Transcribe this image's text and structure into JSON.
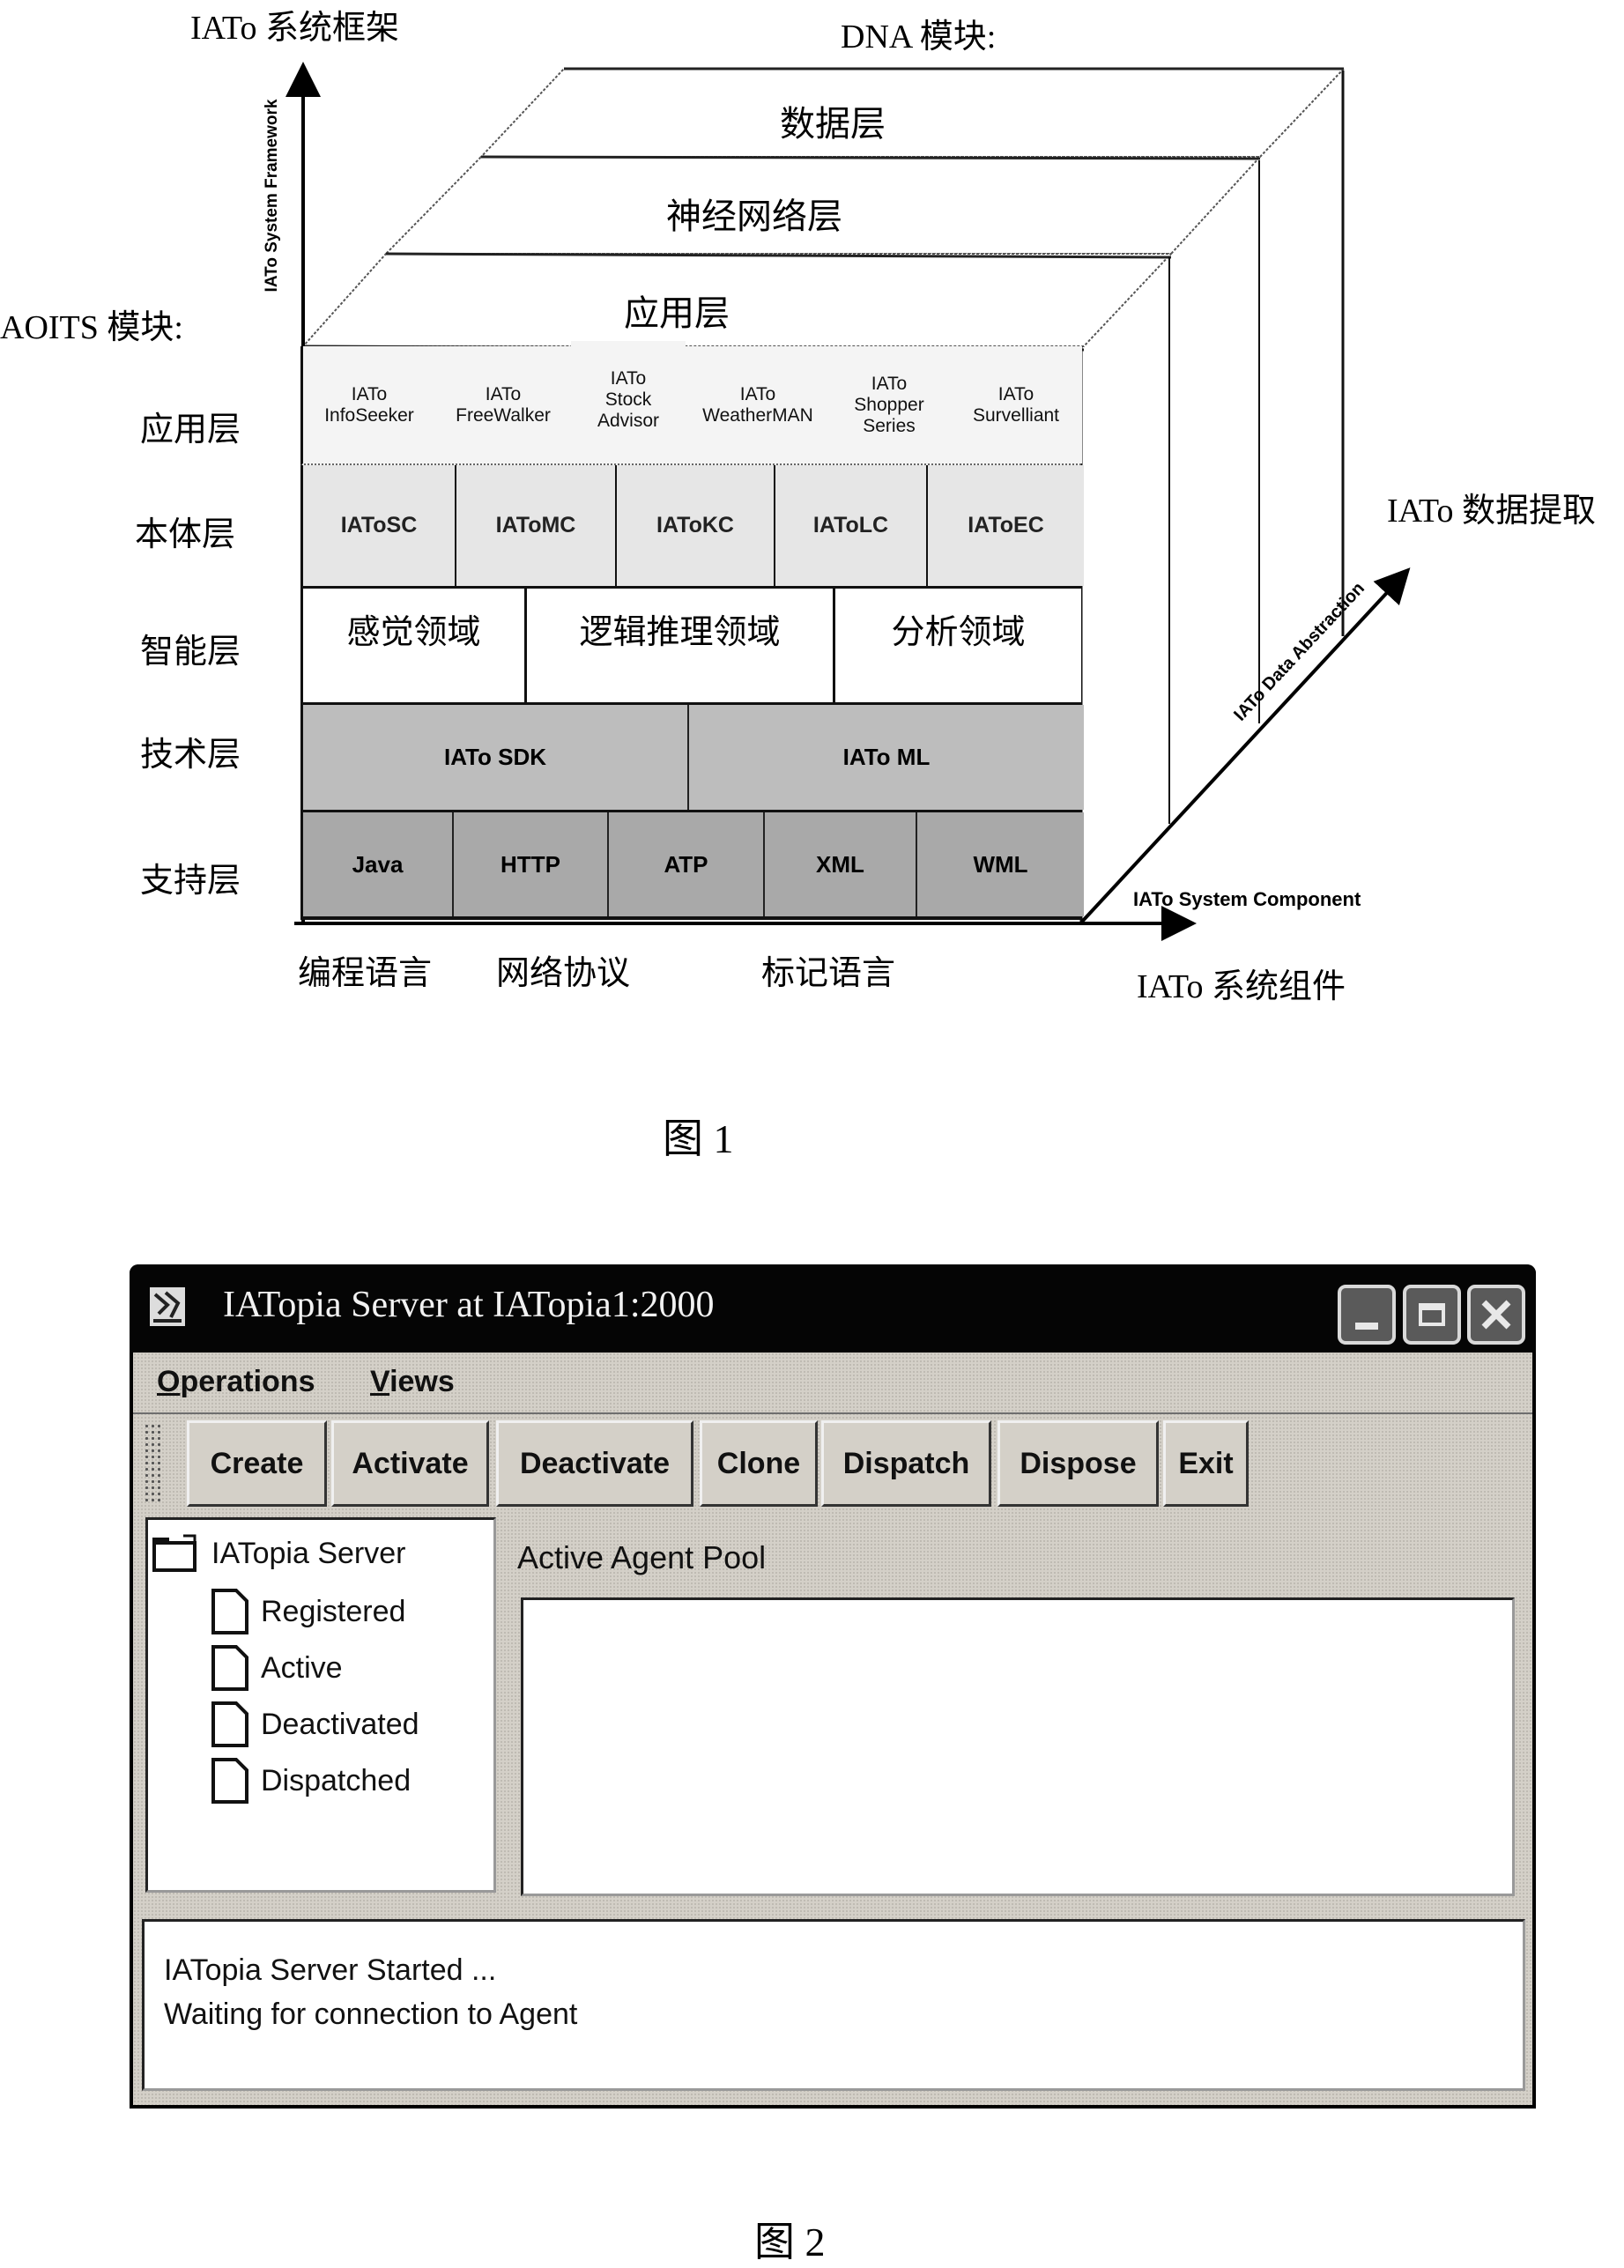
{
  "figure1": {
    "caption": "图 1",
    "y_axis_title": "IATo 系统框架",
    "y_axis_label": "IATo System Framework",
    "x_axis_title": "IATo 系统组件",
    "x_axis_label": "IATo System Component",
    "z_axis_title": "IATo 数据提取",
    "z_axis_label": "IATo Data Abstraction",
    "aoits_title": "AOITS 模块:",
    "dna_title": "DNA 模块:",
    "dna_layers": [
      "数据层",
      "神经网络层",
      "应用层"
    ],
    "aoits_layers": [
      {
        "label": "应用层",
        "cells": [
          "IATo\nInfoSeeker",
          "IATo\nFreeWalker",
          "IATo\nStock\nAdvisor",
          "IATo\nWeatherMAN",
          "IATo\nShopper\nSeries",
          "IATo\nSurvelliant"
        ]
      },
      {
        "label": "本体层",
        "cells": [
          "IAToSC",
          "IAToMC",
          "IAToKC",
          "IAToLC",
          "IAToEC"
        ]
      },
      {
        "label": "智能层",
        "cells": [
          "感觉领域",
          "逻辑推理领域",
          "分析领域"
        ]
      },
      {
        "label": "技术层",
        "cells": [
          "IATo SDK",
          "IATo ML"
        ]
      },
      {
        "label": "支持层",
        "cells": [
          "Java",
          "HTTP",
          "ATP",
          "XML",
          "WML"
        ]
      }
    ],
    "support_groups": [
      "编程语言",
      "网络协议",
      "标记语言"
    ]
  },
  "figure2": {
    "caption": "图 2",
    "window": {
      "title": "IATopia Server at IATopia1:2000",
      "icon": "app-icon",
      "controls": {
        "minimize": "minimize-icon",
        "maximize": "maximize-icon",
        "close": "close-icon"
      }
    },
    "menu": [
      {
        "label": "Operations",
        "mnemonic": "O",
        "rest": "perations"
      },
      {
        "label": "Views",
        "mnemonic": "V",
        "rest": "iews"
      }
    ],
    "toolbar": [
      "Create",
      "Activate",
      "Deactivate",
      "Clone",
      "Dispatch",
      "Dispose",
      "Exit"
    ],
    "tree": {
      "root": "IATopia Server",
      "root_icon": "folder-icon",
      "children": [
        "Registered",
        "Active",
        "Deactivated",
        "Dispatched"
      ],
      "child_icon": "document-icon"
    },
    "pool_label": "Active Agent Pool",
    "pool_items": [],
    "log_lines": [
      "IATopia Server Started ...",
      "Waiting for connection to Agent"
    ]
  }
}
